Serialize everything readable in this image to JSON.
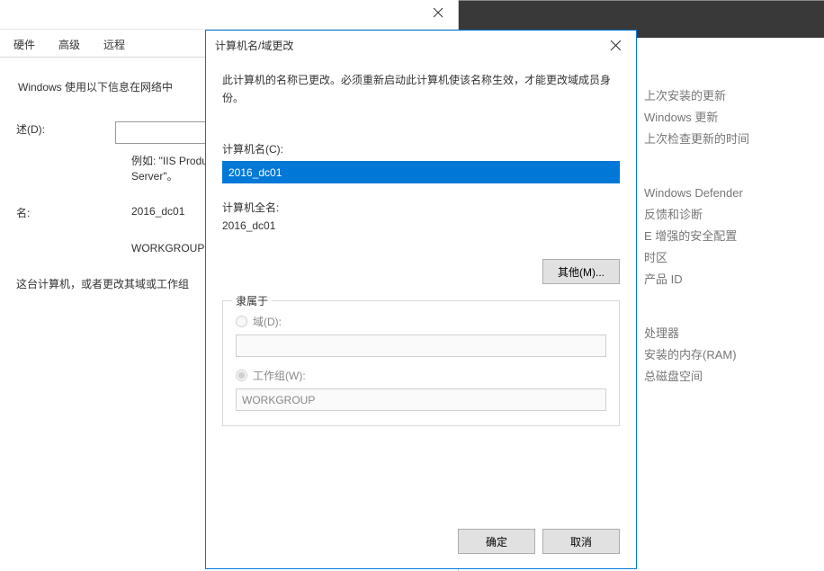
{
  "parent": {
    "tabs": [
      "硬件",
      "高级",
      "远程"
    ],
    "description_line": "Windows 使用以下信息在网络中",
    "desc_label": "述(D):",
    "example_text": "例如: \"IIS Produ\nServer\"。",
    "name_label": "名:",
    "computer_name": "2016_dc01",
    "workgroup": "WORKGROUP",
    "instruction": "这台计算机，或者更改其域或工作组"
  },
  "modal": {
    "title": "计算机名/域更改",
    "message": "此计算机的名称已更改。必须重新启动此计算机使该名称生效，才能更改域成员身份。",
    "computer_name_label": "计算机名(C):",
    "computer_name_value": "2016_dc01",
    "full_name_label": "计算机全名:",
    "full_name_value": "2016_dc01",
    "other_btn": "其他(M)...",
    "member_of_title": "隶属于",
    "domain_label": "域(D):",
    "workgroup_label": "工作组(W):",
    "workgroup_value": "WORKGROUP",
    "ok_btn": "确定",
    "cancel_btn": "取消"
  },
  "right": {
    "s1": [
      "上次安装的更新",
      "Windows 更新",
      "上次检查更新的时间"
    ],
    "s2": [
      "Windows Defender",
      "反馈和诊断",
      "E 增强的安全配置",
      "时区",
      "产品 ID"
    ],
    "s3": [
      "处理器",
      "安装的内存(RAM)",
      "总磁盘空间"
    ]
  }
}
